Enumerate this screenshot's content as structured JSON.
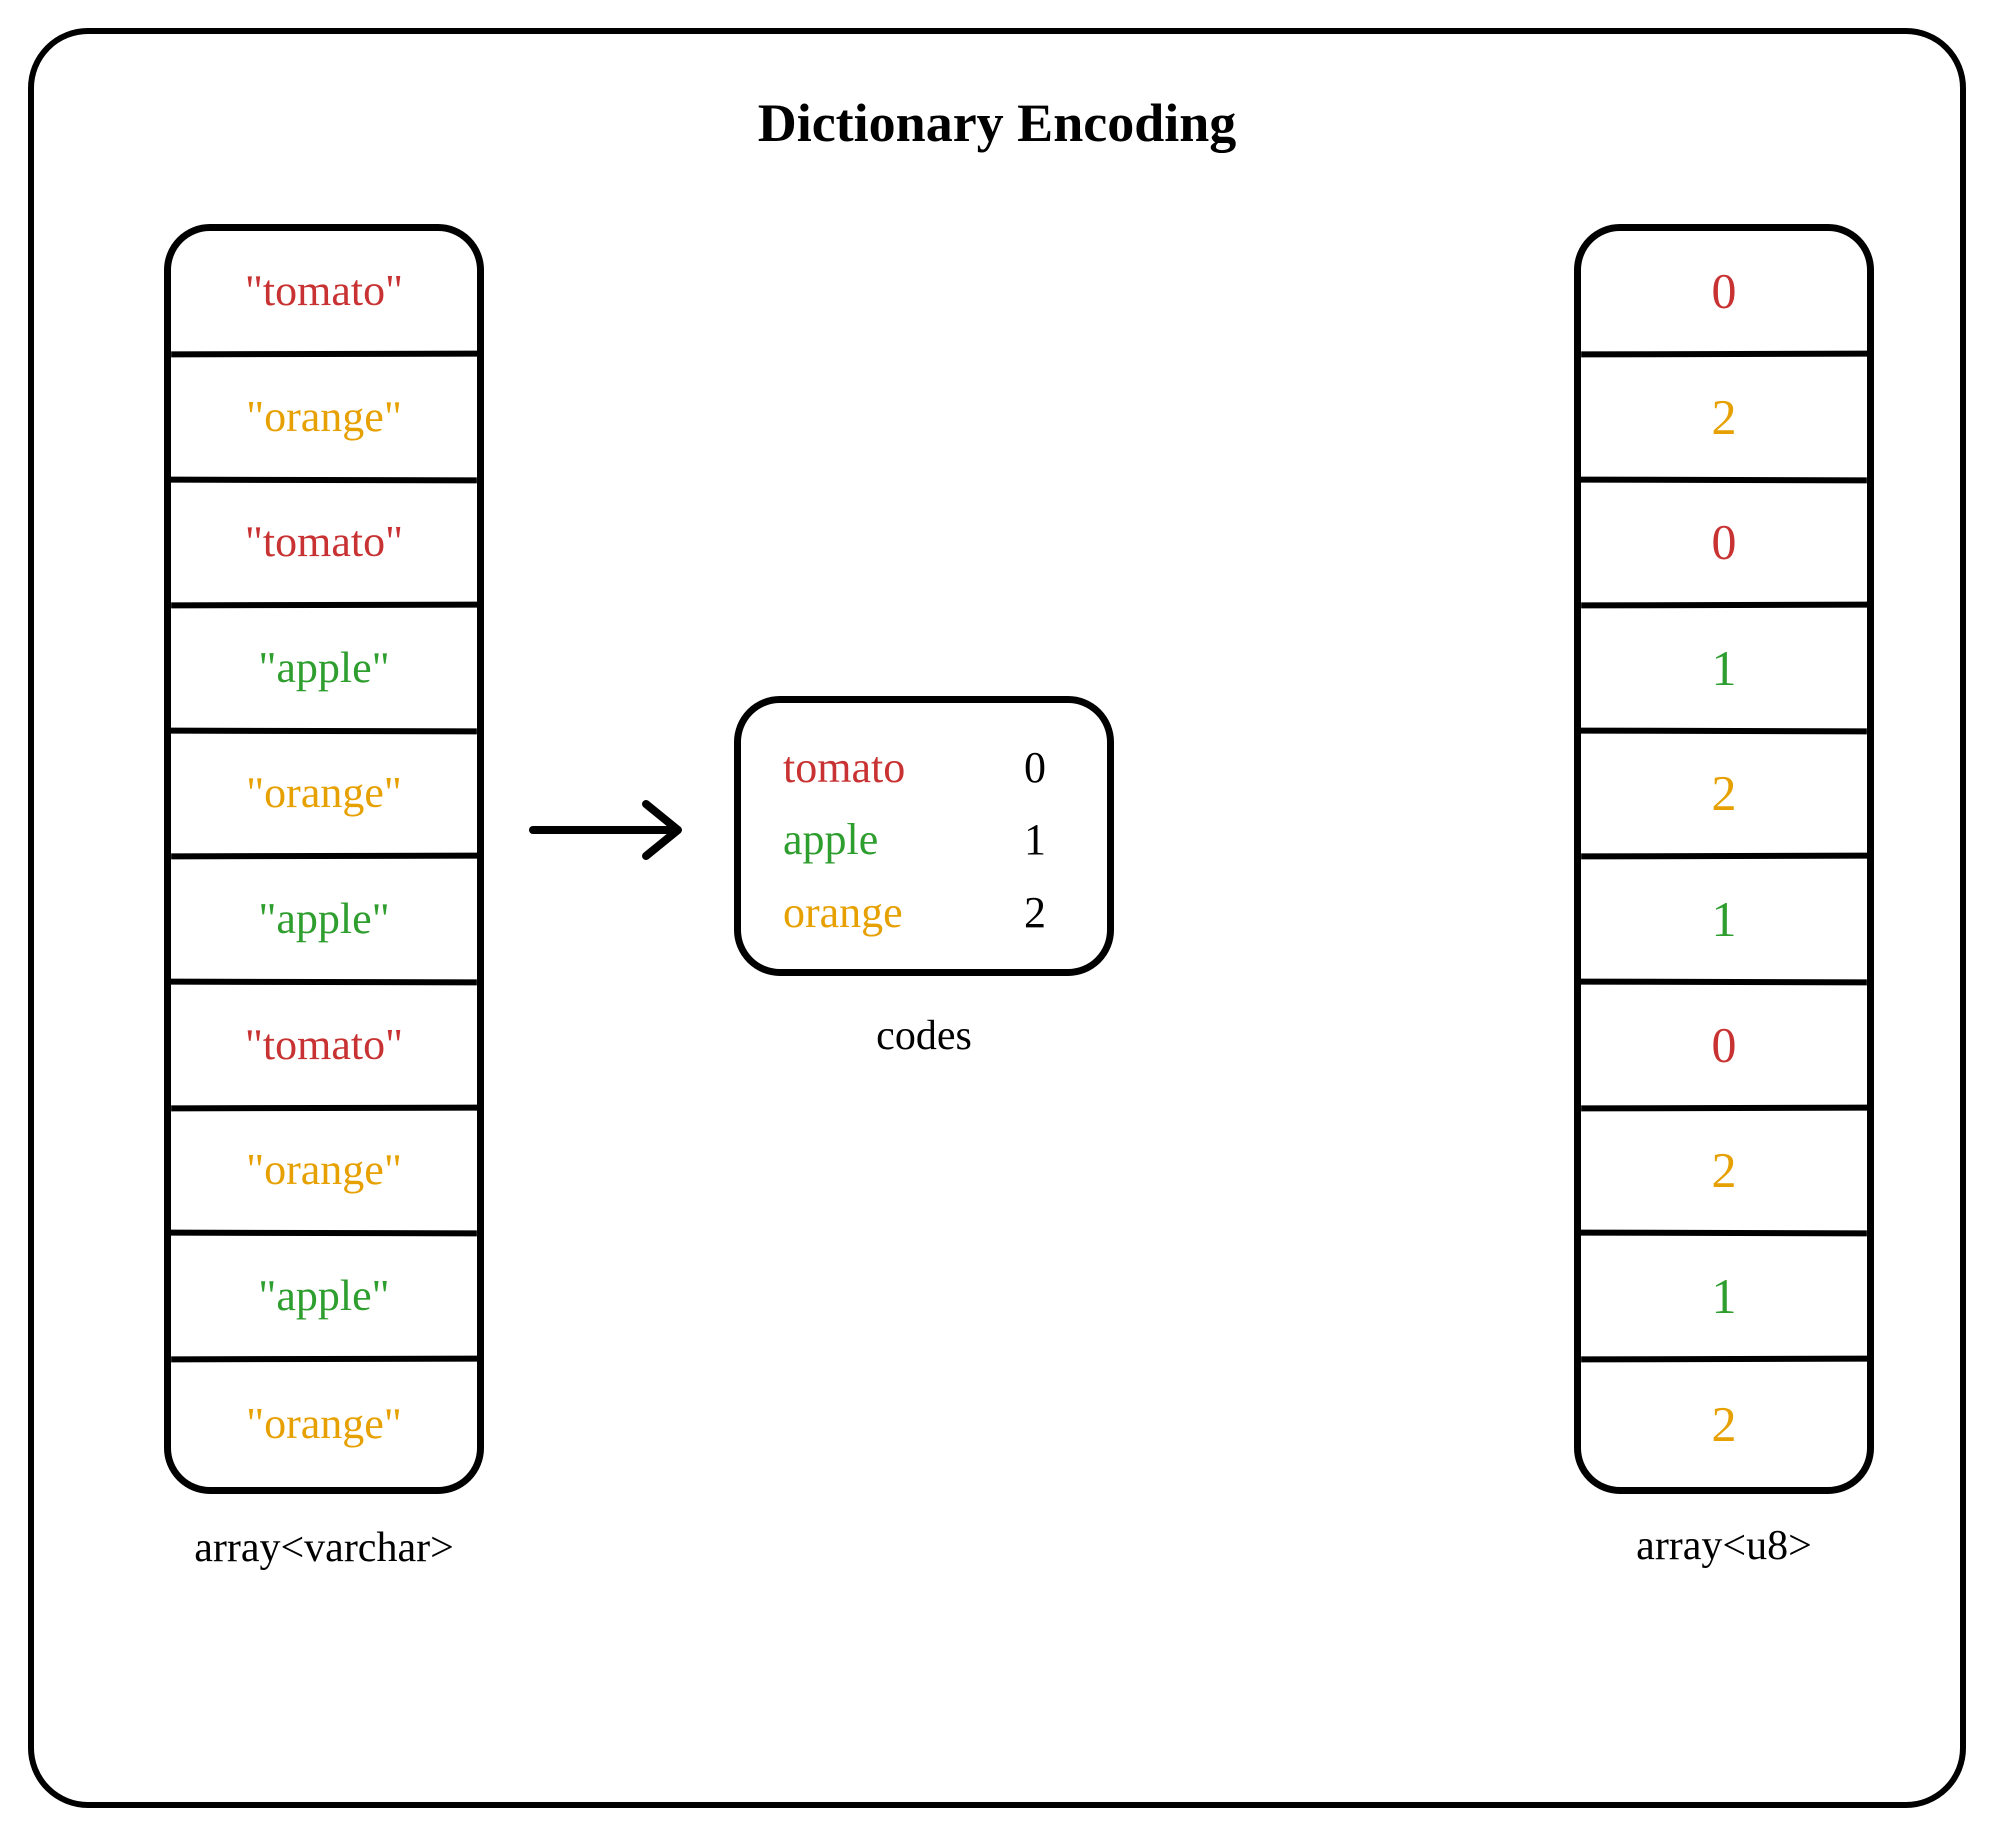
{
  "title": "Dictionary Encoding",
  "colors": {
    "tomato": "#c83232",
    "apple": "#2e9e2e",
    "orange": "#e6a000"
  },
  "left_array": {
    "label": "array<varchar>",
    "values": [
      {
        "text": "\"tomato\"",
        "key": "tomato"
      },
      {
        "text": "\"orange\"",
        "key": "orange"
      },
      {
        "text": "\"tomato\"",
        "key": "tomato"
      },
      {
        "text": "\"apple\"",
        "key": "apple"
      },
      {
        "text": "\"orange\"",
        "key": "orange"
      },
      {
        "text": "\"apple\"",
        "key": "apple"
      },
      {
        "text": "\"tomato\"",
        "key": "tomato"
      },
      {
        "text": "\"orange\"",
        "key": "orange"
      },
      {
        "text": "\"apple\"",
        "key": "apple"
      },
      {
        "text": "\"orange\"",
        "key": "orange"
      }
    ]
  },
  "codes": {
    "label": "codes",
    "rows": [
      {
        "name": "tomato",
        "key": "tomato",
        "code": "0"
      },
      {
        "name": "apple",
        "key": "apple",
        "code": "1"
      },
      {
        "name": "orange",
        "key": "orange",
        "code": "2"
      }
    ]
  },
  "right_array": {
    "label": "array<u8>",
    "values": [
      {
        "text": "0",
        "key": "tomato"
      },
      {
        "text": "2",
        "key": "orange"
      },
      {
        "text": "0",
        "key": "tomato"
      },
      {
        "text": "1",
        "key": "apple"
      },
      {
        "text": "2",
        "key": "orange"
      },
      {
        "text": "1",
        "key": "apple"
      },
      {
        "text": "0",
        "key": "tomato"
      },
      {
        "text": "2",
        "key": "orange"
      },
      {
        "text": "1",
        "key": "apple"
      },
      {
        "text": "2",
        "key": "orange"
      }
    ]
  }
}
